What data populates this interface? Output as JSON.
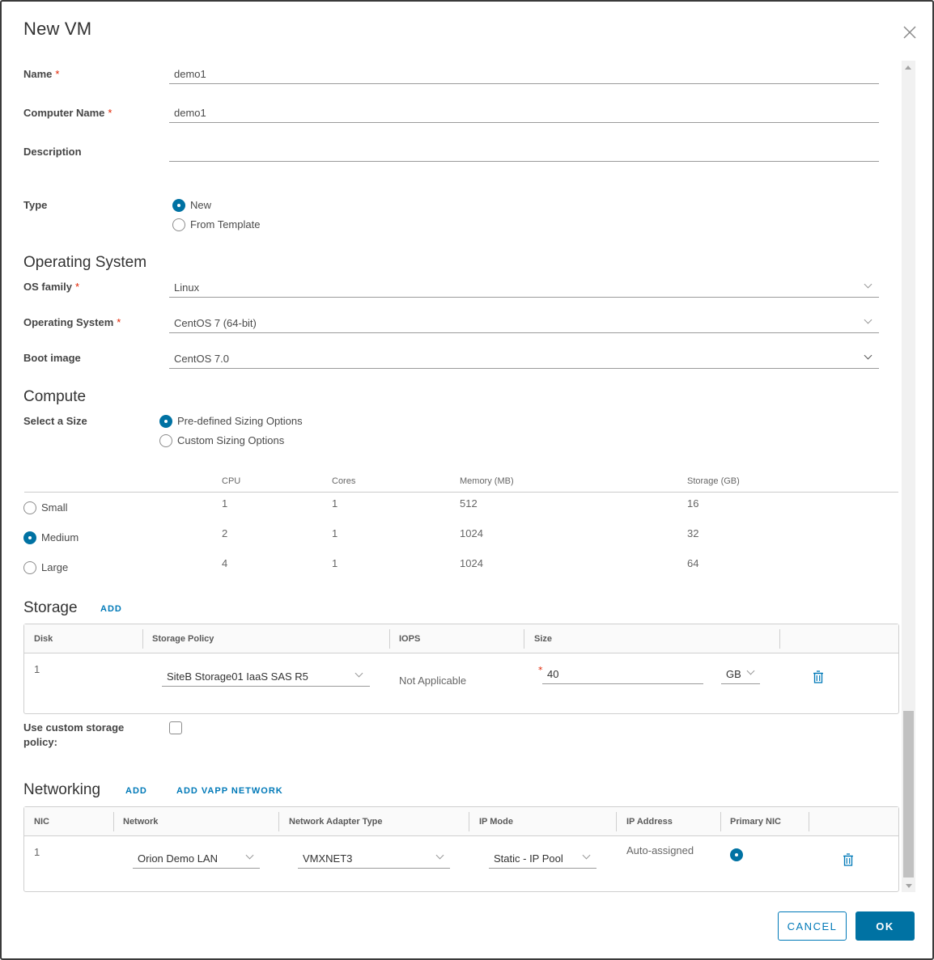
{
  "dialog": {
    "title": "New VM",
    "close_icon": "close-icon"
  },
  "general": {
    "name_label": "Name",
    "name_value": "demo1",
    "computer_name_label": "Computer Name",
    "computer_name_value": "demo1",
    "description_label": "Description",
    "description_value": "",
    "required_marker": "*",
    "type_label": "Type",
    "type_options": [
      {
        "label": "New",
        "selected": true
      },
      {
        "label": "From Template",
        "selected": false
      }
    ]
  },
  "os": {
    "section_title": "Operating System",
    "family_label": "OS family",
    "family_value": "Linux",
    "os_label": "Operating System",
    "os_value": "CentOS 7 (64-bit)",
    "boot_label": "Boot image",
    "boot_value": "CentOS 7.0"
  },
  "compute": {
    "section_title": "Compute",
    "size_label": "Select a Size",
    "size_options": [
      {
        "label": "Pre-defined Sizing Options",
        "selected": true
      },
      {
        "label": "Custom Sizing Options",
        "selected": false
      }
    ],
    "columns": [
      "CPU",
      "Cores",
      "Memory (MB)",
      "Storage (GB)"
    ],
    "rows": [
      {
        "name": "Small",
        "selected": false,
        "cpu": "1",
        "cores": "1",
        "memory": "512",
        "storage": "16"
      },
      {
        "name": "Medium",
        "selected": true,
        "cpu": "2",
        "cores": "1",
        "memory": "1024",
        "storage": "32"
      },
      {
        "name": "Large",
        "selected": false,
        "cpu": "4",
        "cores": "1",
        "memory": "1024",
        "storage": "64"
      }
    ]
  },
  "storage": {
    "section_title": "Storage",
    "add_label": "ADD",
    "columns": [
      "Disk",
      "Storage Policy",
      "IOPS",
      "Size"
    ],
    "rows": [
      {
        "disk": "1",
        "policy": "SiteB Storage01 IaaS SAS R5",
        "iops": "Not Applicable",
        "size": "40",
        "unit": "GB"
      }
    ],
    "custom_policy_label": "Use custom storage policy:",
    "custom_policy_checked": false
  },
  "networking": {
    "section_title": "Networking",
    "add_label": "ADD",
    "add_vapp_label": "ADD VAPP NETWORK",
    "columns": [
      "NIC",
      "Network",
      "Network Adapter Type",
      "IP Mode",
      "IP Address",
      "Primary NIC"
    ],
    "rows": [
      {
        "nic": "1",
        "network": "Orion Demo LAN",
        "adapter": "VMXNET3",
        "ip_mode": "Static - IP Pool",
        "ip_address": "Auto-assigned",
        "primary": true
      }
    ]
  },
  "footer": {
    "cancel_label": "CANCEL",
    "ok_label": "OK"
  },
  "colors": {
    "accent": "#0072a3",
    "link": "#0079b8",
    "required": "#e12200"
  }
}
